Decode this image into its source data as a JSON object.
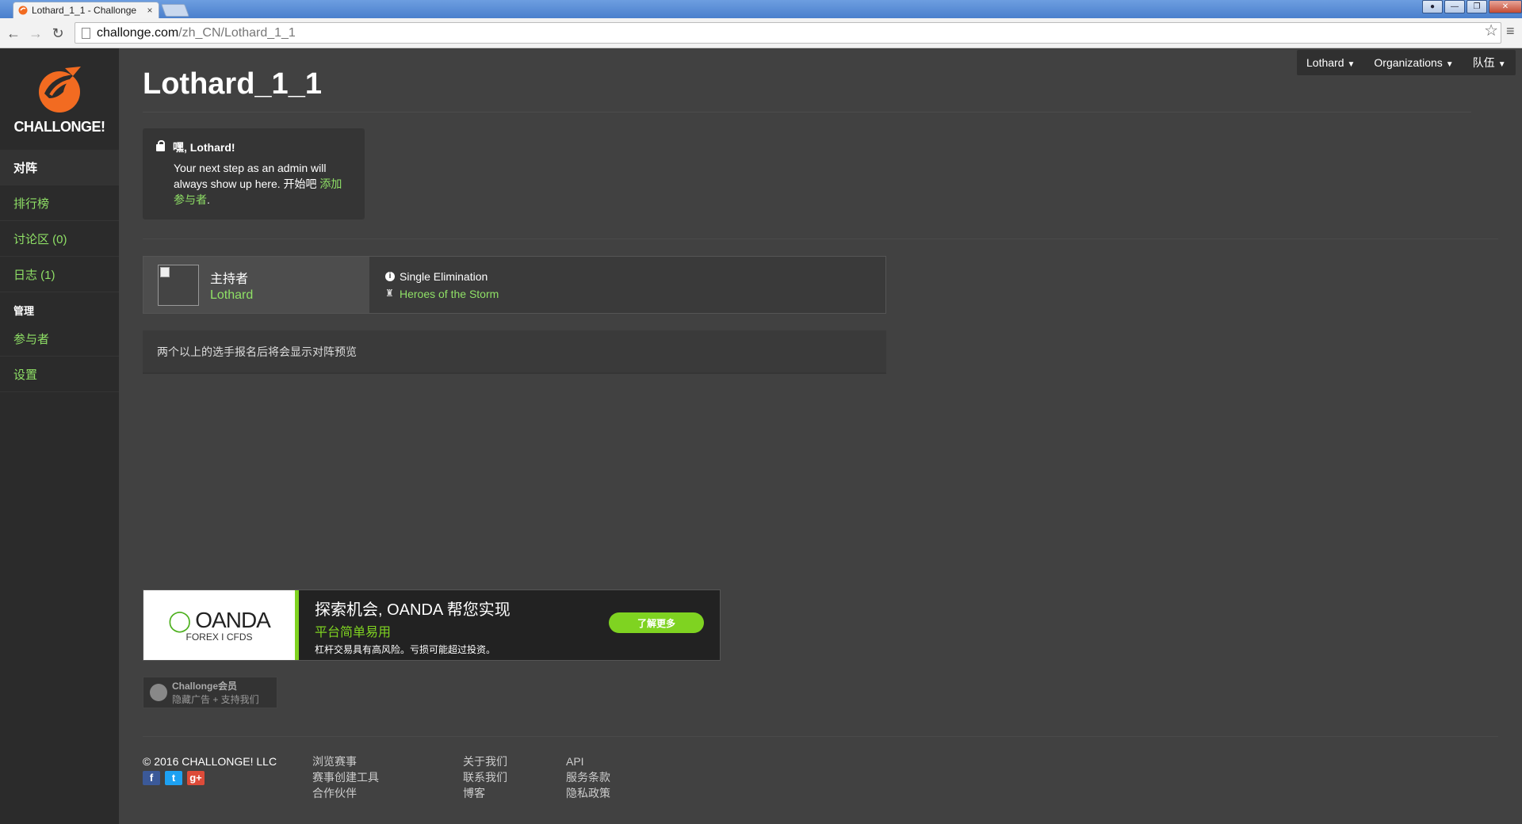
{
  "browser": {
    "tab_title": "Lothard_1_1 - Challonge",
    "tab_close": "×",
    "url_host": "challonge.com",
    "url_path": "/zh_CN/Lothard_1_1"
  },
  "sidebar": {
    "logo_text": "CHALLONGE!",
    "items": [
      {
        "label": "对阵"
      },
      {
        "label": "排行榜"
      },
      {
        "label": "讨论区 (0)"
      },
      {
        "label": "日志 (1)"
      }
    ],
    "admin_header": "管理",
    "admin_items": [
      {
        "label": "参与者"
      },
      {
        "label": "设置"
      }
    ]
  },
  "header": {
    "title": "Lothard_1_1",
    "menu": [
      {
        "label": "Lothard"
      },
      {
        "label": "Organizations"
      },
      {
        "label": "队伍"
      }
    ]
  },
  "admin_note": {
    "greeting": "嘿, Lothard!",
    "text": "Your next step as an admin will always show up here. 开始吧",
    "link": "添加参与者",
    "suffix": "."
  },
  "info": {
    "host_label": "主持者",
    "host_name": "Lothard",
    "format": "Single Elimination",
    "game": "Heroes of the Storm"
  },
  "preview_message": "两个以上的选手报名后将会显示对阵预览",
  "ad": {
    "brand": "OANDA",
    "brand_sub": "FOREX I CFDS",
    "headline": "探索机会, OANDA 帮您实现",
    "subheadline": "平台简单易用",
    "disclaimer": "杠杆交易具有高风险。亏损可能超过投资。",
    "cta": "了解更多"
  },
  "premium": {
    "title": "Challonge会员",
    "subtitle": "隐藏广告 + 支持我们"
  },
  "footer": {
    "copyright": "© 2016 CHALLONGE! LLC",
    "social": [
      "f",
      "t",
      "g+"
    ],
    "col1": [
      "浏览赛事",
      "赛事创建工具",
      "合作伙伴"
    ],
    "col2": [
      "关于我们",
      "联系我们",
      "博客"
    ],
    "col3": [
      "API",
      "服务条款",
      "隐私政策"
    ]
  },
  "colors": {
    "accent_green": "#8fe066",
    "brand_orange": "#f26b21",
    "ad_green": "#7fd321"
  }
}
